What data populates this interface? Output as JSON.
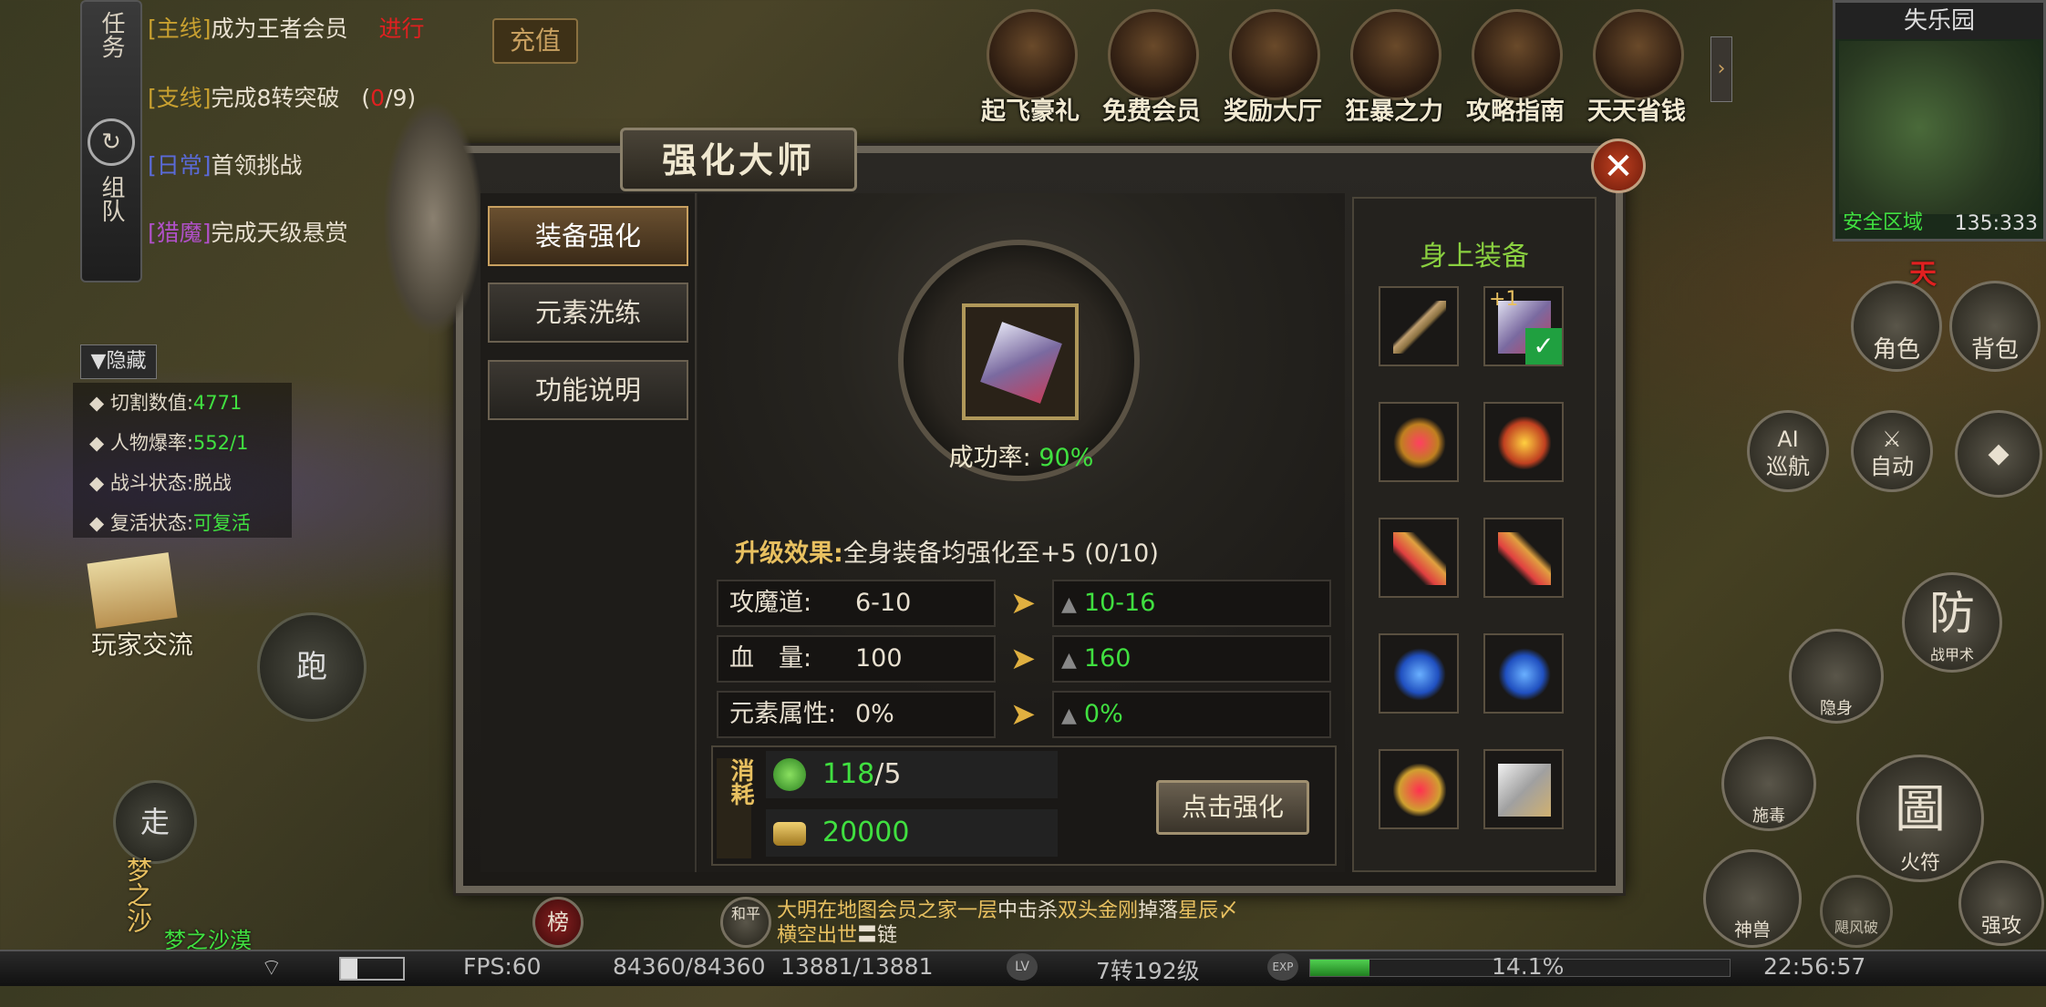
{
  "quests": {
    "tab_task": "任务",
    "tab_team": "组队",
    "items": [
      {
        "tag": "[主线]",
        "text": "成为王者会员",
        "status": "进行"
      },
      {
        "tag": "[支线]",
        "text": "完成8转突破",
        "progress_open": "(",
        "progress_done": "0",
        "progress_rest": "/9)"
      },
      {
        "tag": "[日常]",
        "text": "首领挑战"
      },
      {
        "tag": "[猎魔]",
        "text": "完成天级悬赏"
      }
    ]
  },
  "recharge_label": "充值",
  "top_icons": [
    {
      "label": "起飞豪礼",
      "icon": "gift-icon"
    },
    {
      "label": "免费会员",
      "icon": "crown-icon"
    },
    {
      "label": "奖励大厅",
      "icon": "treasure-chest-icon"
    },
    {
      "label": "狂暴之力",
      "icon": "sword-icon"
    },
    {
      "label": "攻略指南",
      "icon": "scroll-icon"
    },
    {
      "label": "天天省钱",
      "icon": "gold-chest-icon"
    }
  ],
  "minimap": {
    "title": "失乐园",
    "zone": "安全区域",
    "coords": "135:333"
  },
  "dialog": {
    "title": "强化大师",
    "tabs": [
      "装备强化",
      "元素洗练",
      "功能说明"
    ],
    "success_label": "成功率:",
    "success_value": "90%",
    "upgrade_label": "升级效果:",
    "upgrade_text": "全身装备均强化至+5 (0/10)",
    "stats": [
      {
        "name": "攻魔道:",
        "current": "6-10",
        "next": "10-16"
      },
      {
        "name": "血　量:",
        "current": "100",
        "next": "160"
      },
      {
        "name": "元素属性:",
        "current": "0%",
        "next": "0%"
      }
    ],
    "cost_label": "消耗",
    "costs": [
      {
        "have": "118",
        "need": "/5",
        "icon": "jade-icon"
      },
      {
        "have": "20000",
        "need": "",
        "icon": "gold-ingot-icon"
      }
    ],
    "strengthen_button": "点击强化",
    "equipment_title": "身上装备",
    "equipped_plus": "+1"
  },
  "left_status": {
    "hide_label": "隐藏",
    "lines": [
      {
        "label": "切割数值:",
        "value": "4771"
      },
      {
        "label": "人物爆率:",
        "value": "552/1"
      },
      {
        "label": "战斗状态:",
        "value": "脱战"
      },
      {
        "label": "复活状态:",
        "value": "可复活"
      }
    ],
    "player_exchange": "玩家交流"
  },
  "controls": {
    "run": "跑",
    "walk": "走",
    "role": "角色",
    "bag": "背包",
    "ai_cruise": "巡航",
    "ai_label": "AI",
    "auto": "自动",
    "defend": "防",
    "armor_skill": "战甲术",
    "stealth": "隐身",
    "poison": "施毒",
    "fire_charm": "火符",
    "fire_charm_glyph": "圖",
    "divine_beast": "神兽",
    "cyclone": "飓风破",
    "attack": "强攻",
    "rank": "榜",
    "peace": "和平",
    "sky_label": "天",
    "dream_sand": "梦之沙",
    "dream_sand_name": "梦之沙漠"
  },
  "chat": {
    "prefix": "大明在地图",
    "place": "会员之家一层",
    "mid": "中击杀",
    "monster": "双头金刚",
    "drop": "掉落",
    "item": "星辰〆横空出世",
    "item2": "〓链"
  },
  "bottom_bar": {
    "fps": "FPS:60",
    "hp": "84360/84360",
    "mp": "13881/13881",
    "lv_badge": "LV",
    "level": "7转192级",
    "exp_badge": "EXP",
    "exp_percent": "14.1%",
    "exp_fraction": 0.141,
    "clock": "22:56:57"
  },
  "colors": {
    "green": "#40e040",
    "gold": "#e8c060",
    "red": "#e02020"
  }
}
